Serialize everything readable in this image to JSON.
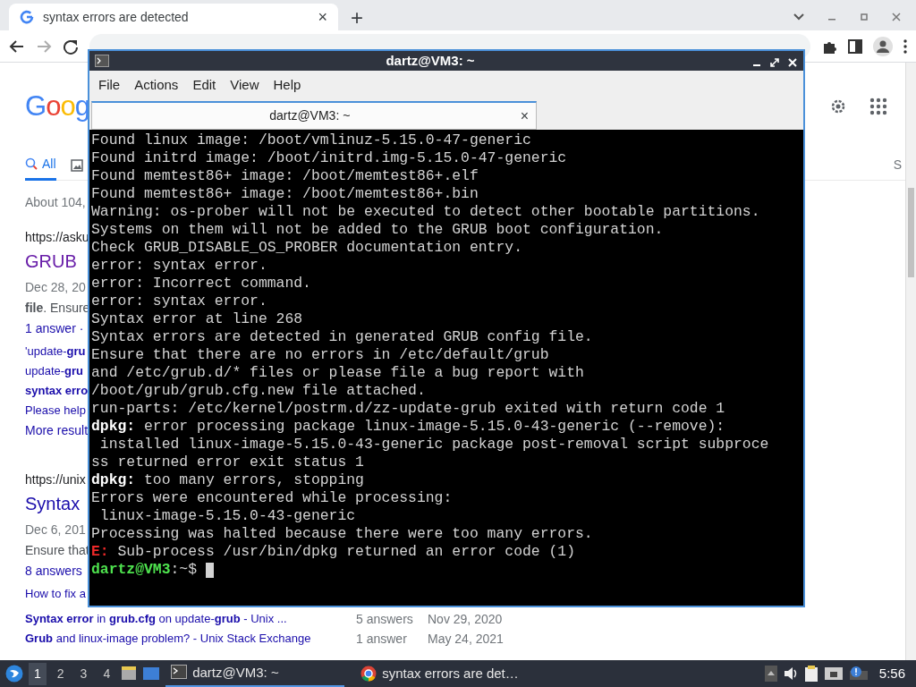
{
  "browser": {
    "tab": {
      "title": "syntax errors are detected",
      "close": "×"
    },
    "new_tab": "+",
    "nav_buttons": [
      {
        "kind": "back",
        "disabled": false
      },
      {
        "kind": "forward",
        "disabled": true
      },
      {
        "kind": "reload",
        "disabled": false
      }
    ]
  },
  "google": {
    "logo": "Goog",
    "tabs": [
      {
        "label": "All",
        "selected": true
      }
    ],
    "side_letter": "S",
    "about": "About 104,",
    "results": [
      {
        "url": "https://asku",
        "title": "GRUB",
        "visited": true,
        "date": "Dec 28, 20",
        "snippet": "**file**. Ensure",
        "answers": "1 answer ·",
        "links": [
          {
            "text": "'update-**gru**"
          },
          {
            "text": "update-**gru**"
          },
          {
            "text": "**syntax erro**"
          },
          {
            "text": "Please help"
          }
        ],
        "more": "More result"
      },
      {
        "url": "https://unix",
        "title": "Syntax",
        "visited": false,
        "date": "Dec 6, 201",
        "snippet": "Ensure that",
        "answers": "8 answers",
        "links": [
          {
            "text": "How to fix a"
          },
          {
            "text": "**Syntax error** in **grub.cfg** on update-**grub** - Unix ...",
            "answers": "5 answers",
            "date": "Nov 29, 2020"
          },
          {
            "text": "**Grub** and linux-image problem? - Unix Stack Exchange",
            "answers": "1 answer",
            "date": "May 24, 2021"
          }
        ]
      }
    ]
  },
  "terminal": {
    "title": "dartz@VM3: ~",
    "menu": [
      "File",
      "Actions",
      "Edit",
      "View",
      "Help"
    ],
    "tab": {
      "title": "dartz@VM3: ~",
      "close": "×"
    },
    "lines": [
      [
        {
          "kind": "plain",
          "text": "Found linux image: /boot/vmlinuz-5.15.0-47-generic"
        }
      ],
      [
        {
          "kind": "plain",
          "text": "Found initrd image: /boot/initrd.img-5.15.0-47-generic"
        }
      ],
      [
        {
          "kind": "plain",
          "text": "Found memtest86+ image: /boot/memtest86+.elf"
        }
      ],
      [
        {
          "kind": "plain",
          "text": "Found memtest86+ image: /boot/memtest86+.bin"
        }
      ],
      [
        {
          "kind": "plain",
          "text": "Warning: os-prober will not be executed to detect other bootable partitions."
        }
      ],
      [
        {
          "kind": "plain",
          "text": "Systems on them will not be added to the GRUB boot configuration."
        }
      ],
      [
        {
          "kind": "plain",
          "text": "Check GRUB_DISABLE_OS_PROBER documentation entry."
        }
      ],
      [
        {
          "kind": "plain",
          "text": "error: syntax error."
        }
      ],
      [
        {
          "kind": "plain",
          "text": "error: Incorrect command."
        }
      ],
      [
        {
          "kind": "plain",
          "text": "error: syntax error."
        }
      ],
      [
        {
          "kind": "plain",
          "text": "Syntax error at line 268"
        }
      ],
      [
        {
          "kind": "plain",
          "text": "Syntax errors are detected in generated GRUB config file."
        }
      ],
      [
        {
          "kind": "plain",
          "text": "Ensure that there are no errors in /etc/default/grub"
        }
      ],
      [
        {
          "kind": "plain",
          "text": "and /etc/grub.d/* files or please file a bug report with"
        }
      ],
      [
        {
          "kind": "plain",
          "text": "/boot/grub/grub.cfg.new file attached."
        }
      ],
      [
        {
          "kind": "plain",
          "text": "run-parts: /etc/kernel/postrm.d/zz-update-grub exited with return code 1"
        }
      ],
      [
        {
          "kind": "bold",
          "text": "dpkg:"
        },
        {
          "kind": "plain",
          "text": " error processing package linux-image-5.15.0-43-generic (--remove):"
        }
      ],
      [
        {
          "kind": "plain",
          "text": " installed linux-image-5.15.0-43-generic package post-removal script subproce"
        }
      ],
      [
        {
          "kind": "plain",
          "text": "ss returned error exit status 1"
        }
      ],
      [
        {
          "kind": "bold",
          "text": "dpkg:"
        },
        {
          "kind": "plain",
          "text": " too many errors, stopping"
        }
      ],
      [
        {
          "kind": "plain",
          "text": "Errors were encountered while processing:"
        }
      ],
      [
        {
          "kind": "plain",
          "text": " linux-image-5.15.0-43-generic"
        }
      ],
      [
        {
          "kind": "plain",
          "text": "Processing was halted because there were too many errors."
        }
      ],
      [
        {
          "kind": "error",
          "text": "E:"
        },
        {
          "kind": "plain",
          "text": " Sub-process /usr/bin/dpkg returned an error code (1)"
        }
      ],
      [
        {
          "kind": "prompt",
          "text": "dartz@VM3"
        },
        {
          "kind": "plain",
          "text": ":~$"
        }
      ]
    ]
  },
  "taskbar": {
    "workspaces": [
      {
        "label": "1",
        "selected": true
      },
      {
        "label": "2",
        "selected": false
      },
      {
        "label": "3",
        "selected": false
      },
      {
        "label": "4",
        "selected": false
      }
    ],
    "tasks": [
      {
        "kind": "terminal",
        "label": "dartz@VM3: ~",
        "selected": true
      },
      {
        "kind": "chrome",
        "label": "syntax errors are det…",
        "selected": false
      }
    ],
    "clock": "5:56"
  }
}
